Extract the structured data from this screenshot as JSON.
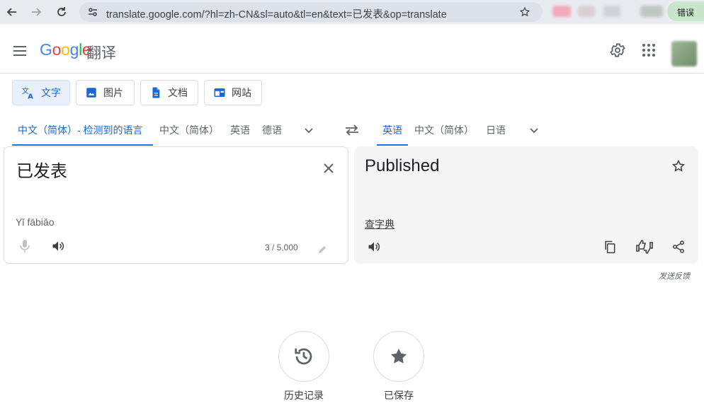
{
  "browser": {
    "url": "translate.google.com/?hl=zh-CN&sl=auto&tl=en&text=已发表&op=translate",
    "error_badge": "错误"
  },
  "header": {
    "logo_text": "Google",
    "product_name": "翻译"
  },
  "modes": [
    {
      "label": "文字",
      "icon": "translate-icon",
      "active": true
    },
    {
      "label": "图片",
      "icon": "image-icon",
      "active": false
    },
    {
      "label": "文档",
      "icon": "document-icon",
      "active": false
    },
    {
      "label": "网站",
      "icon": "website-icon",
      "active": false
    }
  ],
  "source_languages": [
    "中文（简体）- 检测到的语言",
    "中文（简体）",
    "英语",
    "德语"
  ],
  "target_languages": [
    "英语",
    "中文（简体）",
    "日语"
  ],
  "source": {
    "text": "已发表",
    "romanization": "Yǐ fābiǎo",
    "char_count": "3 / 5,000"
  },
  "target": {
    "text": "Published",
    "dictionary_link": "查字典"
  },
  "feedback_link": "发送反馈",
  "bottom_actions": [
    {
      "label": "历史记录",
      "icon": "history-icon"
    },
    {
      "label": "已保存",
      "icon": "star-icon"
    }
  ],
  "colors": {
    "accent": "#1a73e8",
    "google_blue": "#4285f4",
    "google_red": "#ea4335",
    "google_yellow": "#fbbc05",
    "google_green": "#34a853"
  }
}
